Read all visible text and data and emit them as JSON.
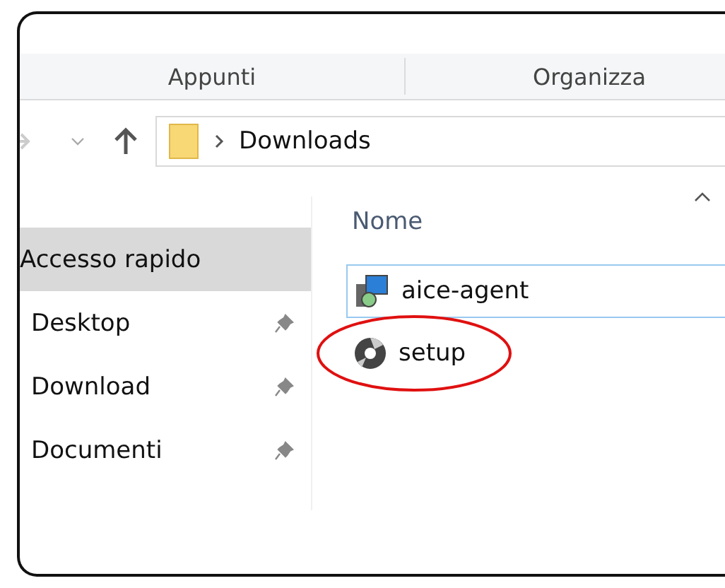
{
  "ribbon_groups": [
    "Appunti",
    "Organizza"
  ],
  "address": {
    "path": "Downloads"
  },
  "sidebar": {
    "items": [
      {
        "label": "Accesso rapido",
        "selected": true,
        "pinned": false
      },
      {
        "label": "Desktop",
        "selected": false,
        "pinned": true
      },
      {
        "label": "Download",
        "selected": false,
        "pinned": true
      },
      {
        "label": "Documenti",
        "selected": false,
        "pinned": true
      }
    ]
  },
  "file_list": {
    "column": "Nome",
    "sort_ascending": true,
    "files": [
      {
        "name": "aice-agent",
        "kind": "installer",
        "focused": true,
        "circled": false
      },
      {
        "name": "setup",
        "kind": "disc",
        "focused": false,
        "circled": true
      }
    ]
  }
}
